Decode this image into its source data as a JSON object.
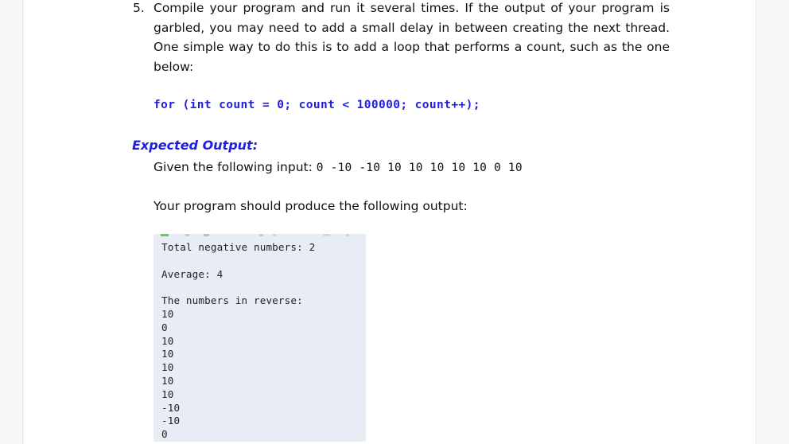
{
  "document": {
    "list_item": {
      "marker": "5.",
      "text": "Compile your program and run it several times. If the output of your program is garbled, you may need to add a small delay in between creating the next thread. One simple way to do this is to add a loop that performs a count, such as the one below:"
    },
    "code_snippet": "for (int count = 0; count < 100000; count++);",
    "expected_output_heading": "Expected Output:",
    "given_input_label": "Given the following input:",
    "given_input_values": "0 -10 -10 10 10 10 10 10 0 10",
    "produce_output_label": "Your program should produce the following output:",
    "console_output": {
      "lines": [
        "Total negative numbers: 2",
        "",
        "Average: 4",
        "",
        "The numbers in reverse:",
        "10",
        "0",
        "10",
        "10",
        "10",
        "10",
        "10",
        "-10",
        "-10",
        "0"
      ]
    }
  },
  "colors": {
    "code_blue": "#2020dd",
    "heading_blue": "#2020dd",
    "body_text": "#111111",
    "console_background": "#e8ecf5",
    "console_text": "#222226",
    "page_background": "#ffffff",
    "viewer_background": "#f6f7f9"
  }
}
